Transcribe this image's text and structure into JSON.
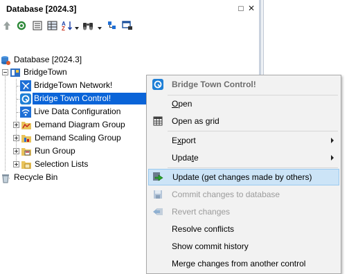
{
  "pane": {
    "title": "Database [2024.3]",
    "restore_glyph": "□",
    "close_glyph": "✕"
  },
  "toolbar": {
    "icons": [
      "up-arrow-icon",
      "refresh-icon",
      "list-icon",
      "grid-icon",
      "sort-icon",
      "binoculars-icon",
      "tree-filter-icon",
      "locate-icon"
    ]
  },
  "tree": {
    "root": "Database [2024.3]",
    "network_group": "BridgeTown",
    "items": [
      "BridgeTown Network!",
      "Bridge Town Control!",
      "Live Data Configuration",
      "Demand Diagram Group",
      "Demand Scaling Group",
      "Run Group",
      "Selection Lists"
    ],
    "recycle_bin": "Recycle Bin",
    "selected": "Bridge Town Control!"
  },
  "context_menu": {
    "header": "Bridge Town Control!",
    "items": [
      {
        "pre": "",
        "key": "O",
        "post": "pen"
      },
      {
        "pre": "Open as ",
        "key": "g",
        "post": "rid"
      },
      {
        "pre": "E",
        "key": "x",
        "post": "port"
      },
      {
        "pre": "Upda",
        "key": "t",
        "post": "e"
      },
      {
        "pre": "Update (get changes made by others)",
        "key": "",
        "post": ""
      },
      {
        "pre": "Commit changes to database",
        "key": "",
        "post": ""
      },
      {
        "pre": "Revert changes",
        "key": "",
        "post": ""
      },
      {
        "pre": "Resolve conflicts",
        "key": "",
        "post": ""
      },
      {
        "pre": "Show commit history",
        "key": "",
        "post": ""
      },
      {
        "pre": "Merge changes from another control",
        "key": "",
        "post": ""
      }
    ]
  },
  "colors": {
    "selection": "#0a64d8",
    "menu_highlight": "#cce4f7",
    "menu_background": "#f2f2f2",
    "disabled_text": "#9b9b9b"
  }
}
